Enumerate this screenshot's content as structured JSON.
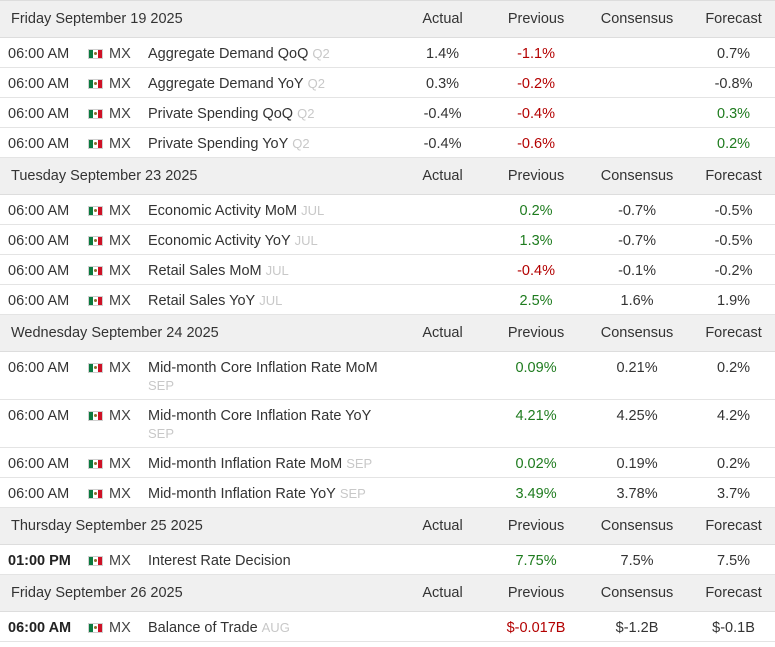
{
  "columns": {
    "actual": "Actual",
    "previous": "Previous",
    "consensus": "Consensus",
    "forecast": "Forecast"
  },
  "colors": {
    "negative": "#b30000",
    "positive": "#1e7b1e",
    "reference": "#c8c8c8"
  },
  "days": [
    {
      "date": "Friday September 19 2025",
      "events": [
        {
          "time": "06:00 AM",
          "bold_time": false,
          "country": "MX",
          "event": "Aggregate Demand QoQ",
          "reference": "Q2",
          "actual": "1.4%",
          "previous": "-1.1%",
          "previous_color": "red",
          "consensus": "",
          "forecast": "0.7%",
          "forecast_color": "neutral"
        },
        {
          "time": "06:00 AM",
          "bold_time": false,
          "country": "MX",
          "event": "Aggregate Demand YoY",
          "reference": "Q2",
          "actual": "0.3%",
          "previous": "-0.2%",
          "previous_color": "red",
          "consensus": "",
          "forecast": "-0.8%",
          "forecast_color": "neutral"
        },
        {
          "time": "06:00 AM",
          "bold_time": false,
          "country": "MX",
          "event": "Private Spending QoQ",
          "reference": "Q2",
          "actual": "-0.4%",
          "previous": "-0.4%",
          "previous_color": "red",
          "consensus": "",
          "forecast": "0.3%",
          "forecast_color": "green"
        },
        {
          "time": "06:00 AM",
          "bold_time": false,
          "country": "MX",
          "event": "Private Spending YoY",
          "reference": "Q2",
          "actual": "-0.4%",
          "previous": "-0.6%",
          "previous_color": "red",
          "consensus": "",
          "forecast": "0.2%",
          "forecast_color": "green"
        }
      ]
    },
    {
      "date": "Tuesday September 23 2025",
      "events": [
        {
          "time": "06:00 AM",
          "bold_time": false,
          "country": "MX",
          "event": "Economic Activity MoM",
          "reference": "JUL",
          "actual": "",
          "previous": "0.2%",
          "previous_color": "green",
          "consensus": "-0.7%",
          "forecast": "-0.5%",
          "forecast_color": "neutral"
        },
        {
          "time": "06:00 AM",
          "bold_time": false,
          "country": "MX",
          "event": "Economic Activity YoY",
          "reference": "JUL",
          "actual": "",
          "previous": "1.3%",
          "previous_color": "green",
          "consensus": "-0.7%",
          "forecast": "-0.5%",
          "forecast_color": "neutral"
        },
        {
          "time": "06:00 AM",
          "bold_time": false,
          "country": "MX",
          "event": "Retail Sales MoM",
          "reference": "JUL",
          "actual": "",
          "previous": "-0.4%",
          "previous_color": "red",
          "consensus": "-0.1%",
          "forecast": "-0.2%",
          "forecast_color": "neutral"
        },
        {
          "time": "06:00 AM",
          "bold_time": false,
          "country": "MX",
          "event": "Retail Sales YoY",
          "reference": "JUL",
          "actual": "",
          "previous": "2.5%",
          "previous_color": "green",
          "consensus": "1.6%",
          "forecast": "1.9%",
          "forecast_color": "neutral"
        }
      ]
    },
    {
      "date": "Wednesday September 24 2025",
      "events": [
        {
          "time": "06:00 AM",
          "bold_time": false,
          "country": "MX",
          "event": "Mid-month Core Inflation Rate MoM",
          "reference": "SEP",
          "ref_wrap": true,
          "actual": "",
          "previous": "0.09%",
          "previous_color": "green",
          "consensus": "0.21%",
          "forecast": "0.2%",
          "forecast_color": "neutral"
        },
        {
          "time": "06:00 AM",
          "bold_time": false,
          "country": "MX",
          "event": "Mid-month Core Inflation Rate YoY",
          "reference": "SEP",
          "ref_wrap": true,
          "actual": "",
          "previous": "4.21%",
          "previous_color": "green",
          "consensus": "4.25%",
          "forecast": "4.2%",
          "forecast_color": "neutral"
        },
        {
          "time": "06:00 AM",
          "bold_time": false,
          "country": "MX",
          "event": "Mid-month Inflation Rate MoM",
          "reference": "SEP",
          "actual": "",
          "previous": "0.02%",
          "previous_color": "green",
          "consensus": "0.19%",
          "forecast": "0.2%",
          "forecast_color": "neutral"
        },
        {
          "time": "06:00 AM",
          "bold_time": false,
          "country": "MX",
          "event": "Mid-month Inflation Rate YoY",
          "reference": "SEP",
          "actual": "",
          "previous": "3.49%",
          "previous_color": "green",
          "consensus": "3.78%",
          "forecast": "3.7%",
          "forecast_color": "neutral"
        }
      ]
    },
    {
      "date": "Thursday September 25 2025",
      "events": [
        {
          "time": "01:00 PM",
          "bold_time": true,
          "country": "MX",
          "event": "Interest Rate Decision",
          "reference": "",
          "actual": "",
          "previous": "7.75%",
          "previous_color": "green",
          "consensus": "7.5%",
          "forecast": "7.5%",
          "forecast_color": "neutral"
        }
      ]
    },
    {
      "date": "Friday September 26 2025",
      "events": [
        {
          "time": "06:00 AM",
          "bold_time": true,
          "country": "MX",
          "event": "Balance of Trade",
          "reference": "AUG",
          "actual": "",
          "previous": "$-0.017B",
          "previous_color": "red",
          "consensus": "$-1.2B",
          "forecast": "$-0.1B",
          "forecast_color": "neutral"
        }
      ]
    }
  ]
}
